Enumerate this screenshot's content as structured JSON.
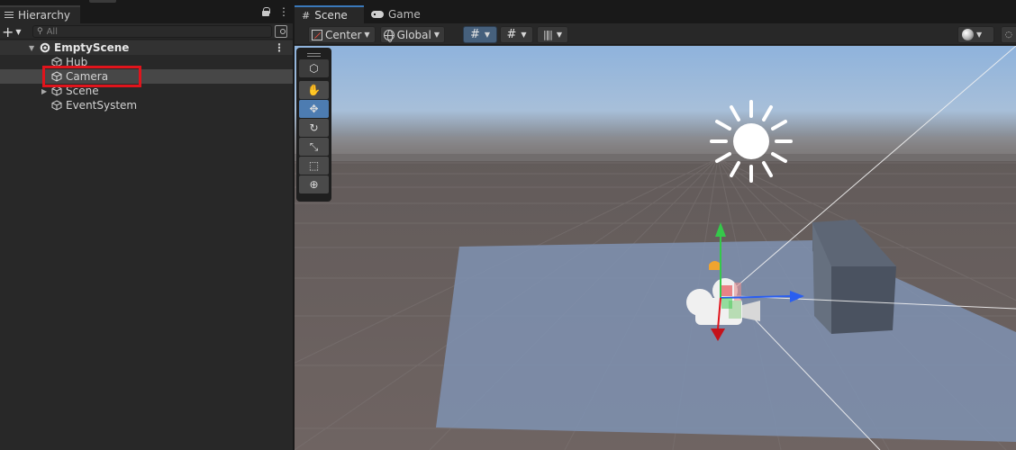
{
  "hierarchy": {
    "tab_label": "Hierarchy",
    "add_label": "+",
    "search_placeholder": "All",
    "scene_name": "EmptyScene",
    "items": [
      {
        "label": "Hub",
        "selected": false,
        "expandable": false
      },
      {
        "label": "Camera",
        "selected": true,
        "expandable": false
      },
      {
        "label": "Scene",
        "selected": false,
        "expandable": true
      },
      {
        "label": "EventSystem",
        "selected": false,
        "expandable": false
      }
    ]
  },
  "scene_view": {
    "tabs": [
      {
        "label": "Scene",
        "icon": "hash-icon",
        "active": true
      },
      {
        "label": "Game",
        "icon": "gamepad-icon",
        "active": false
      }
    ],
    "pivot_label": "Center",
    "space_label": "Global",
    "tools": [
      "view-tool",
      "hand-tool",
      "move-tool",
      "rotate-tool",
      "scale-tool",
      "rect-tool",
      "transform-tool"
    ],
    "active_tool": "move-tool"
  },
  "colors": {
    "selection_highlight": "#e0141c",
    "active_tab_accent": "#3a79bb",
    "gizmo_x": "#e0141c",
    "gizmo_y": "#35c84a",
    "gizmo_z": "#2a5ef0",
    "active_tool": "#4d7cb1"
  }
}
